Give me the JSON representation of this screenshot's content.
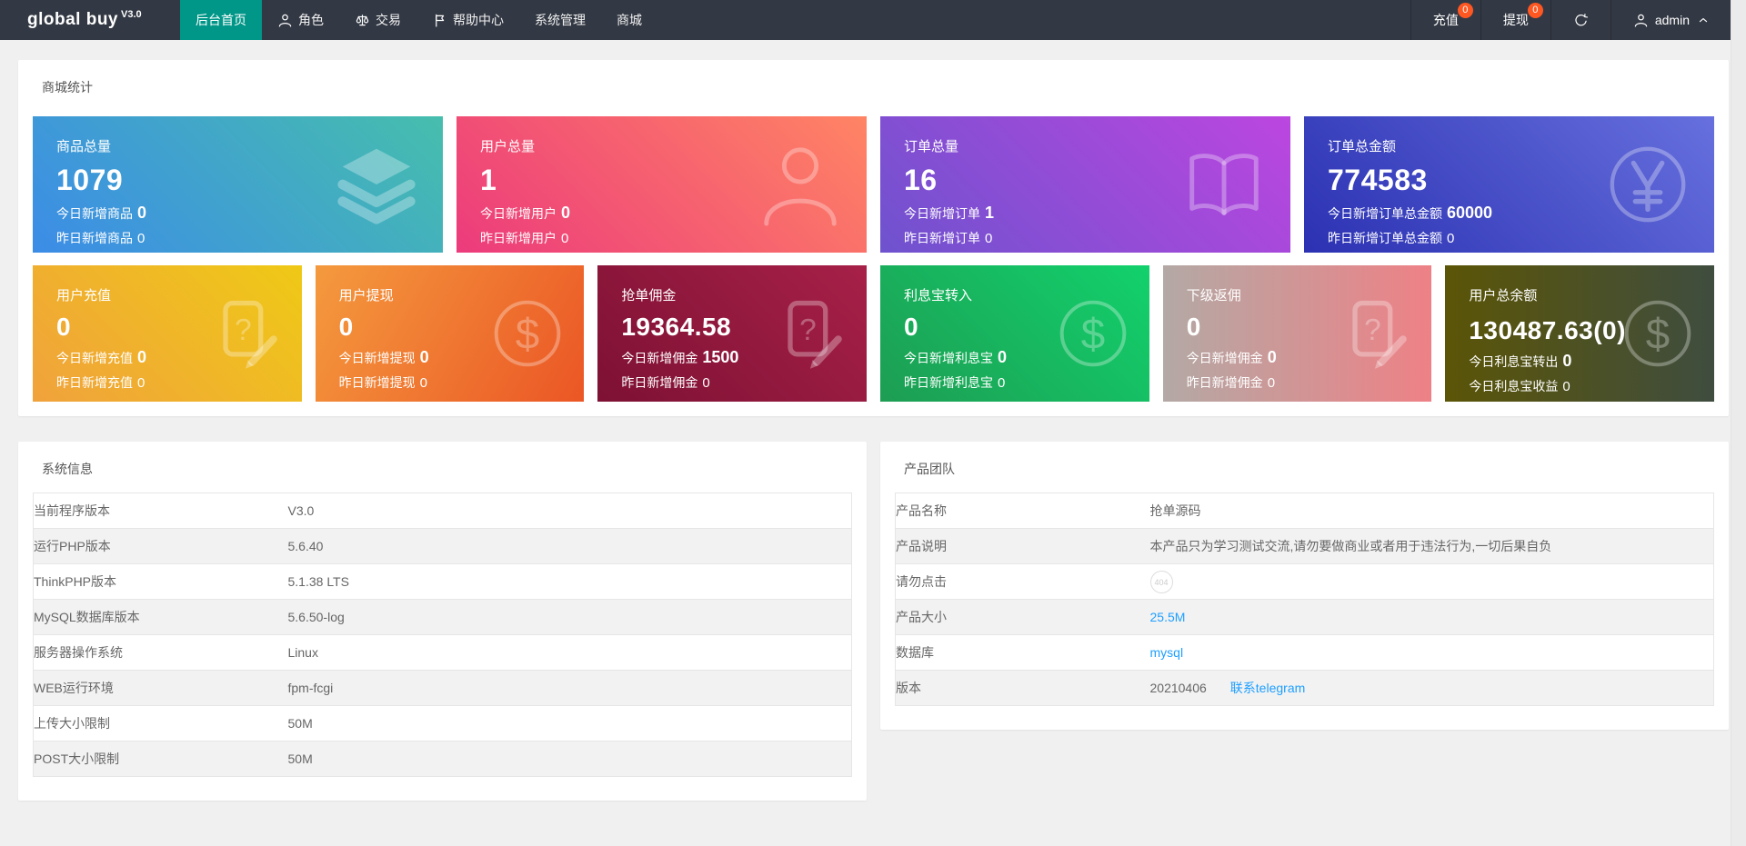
{
  "navbar": {
    "logo_text": "global buy",
    "logo_version": "V3.0",
    "menu": [
      {
        "name": "home",
        "label": "后台首页",
        "active": true
      },
      {
        "name": "roles",
        "label": "角色",
        "icon": "user-icon"
      },
      {
        "name": "trade",
        "label": "交易",
        "icon": "scales-icon"
      },
      {
        "name": "help",
        "label": "帮助中心",
        "icon": "flag-icon"
      },
      {
        "name": "system",
        "label": "系统管理"
      },
      {
        "name": "mall",
        "label": "商城"
      }
    ],
    "actions": [
      {
        "name": "recharge",
        "label": "充值",
        "badge": "0"
      },
      {
        "name": "withdraw",
        "label": "提现",
        "badge": "0"
      },
      {
        "name": "refresh",
        "icon": "refresh-icon"
      },
      {
        "name": "user-menu",
        "label": "admin",
        "icon": "user-icon",
        "caret": true
      }
    ]
  },
  "stats": {
    "title": "商城统计",
    "row1": [
      {
        "name": "goods-total",
        "title": "商品总量",
        "value": "1079",
        "today_label": "今日新增商品",
        "today_value": "0",
        "yesterday_label": "昨日新增商品",
        "yesterday_value": "0",
        "icon": "layers-icon",
        "gradient": [
          "#3C8CE7",
          "#46BEAD"
        ],
        "angle": "45deg"
      },
      {
        "name": "user-total",
        "title": "用户总量",
        "value": "1",
        "today_label": "今日新增用户",
        "today_value": "0",
        "yesterday_label": "昨日新增用户",
        "yesterday_value": "0",
        "icon": "person-icon",
        "gradient": [
          "#EC3B7C",
          "#FF8464"
        ],
        "angle": "45deg"
      },
      {
        "name": "order-total",
        "title": "订单总量",
        "value": "16",
        "today_label": "今日新增订单",
        "today_value": "1",
        "yesterday_label": "昨日新增订单",
        "yesterday_value": "0",
        "icon": "book-icon",
        "gradient": [
          "#6E52CE",
          "#BC46E0"
        ],
        "angle": "45deg"
      },
      {
        "name": "order-amount",
        "title": "订单总金额",
        "value": "774583",
        "today_label": "今日新增订单总金额",
        "today_value": "60000",
        "yesterday_label": "昨日新增订单总金额",
        "yesterday_value": "0",
        "icon": "yen-icon",
        "gradient": [
          "#2B31B2",
          "#6770DE"
        ],
        "angle": "45deg"
      }
    ],
    "row2": [
      {
        "name": "user-recharge",
        "title": "用户充值",
        "value": "0",
        "today_label": "今日新增充值",
        "today_value": "0",
        "yesterday_label": "昨日新增充值",
        "yesterday_value": "0",
        "icon": "doc-question-icon",
        "gradient": [
          "#F0A23C",
          "#EFC916"
        ],
        "angle": "45deg"
      },
      {
        "name": "user-withdraw",
        "title": "用户提现",
        "value": "0",
        "today_label": "今日新增提现",
        "today_value": "0",
        "yesterday_label": "昨日新增提现",
        "yesterday_value": "0",
        "icon": "dollar-icon",
        "gradient": [
          "#F49A3E",
          "#EB5625"
        ],
        "angle": "120deg"
      },
      {
        "name": "order-commission",
        "title": "抢单佣金",
        "value": "19364.58",
        "today_label": "今日新增佣金",
        "today_value": "1500",
        "yesterday_label": "昨日新增佣金",
        "yesterday_value": "0",
        "icon": "doc-question-icon",
        "gradient": [
          "#7D1134",
          "#A72048"
        ],
        "angle": "45deg"
      },
      {
        "name": "interest-in",
        "title": "利息宝转入",
        "value": "0",
        "today_label": "今日新增利息宝",
        "today_value": "0",
        "yesterday_label": "昨日新增利息宝",
        "yesterday_value": "0",
        "icon": "dollar-icon",
        "gradient": [
          "#1D9D53",
          "#12D16C"
        ],
        "angle": "45deg"
      },
      {
        "name": "sub-commission",
        "title": "下级返佣",
        "value": "0",
        "today_label": "今日新增佣金",
        "today_value": "0",
        "yesterday_label": "昨日新增佣金",
        "yesterday_value": "0",
        "icon": "doc-question-icon",
        "gradient": [
          "#B3A9A5",
          "#EE8186"
        ],
        "angle": "90deg"
      },
      {
        "name": "user-balance",
        "title": "用户总余额",
        "value": "130487.63(0)",
        "value_small": true,
        "today_label": "今日利息宝转出",
        "today_value": "0",
        "yesterday_label": "今日利息宝收益",
        "yesterday_value": "0",
        "icon": "dollar-icon",
        "gradient": [
          "#5B5507",
          "#3F4D3F"
        ],
        "angle": "90deg"
      }
    ]
  },
  "system_info": {
    "title": "系统信息",
    "rows": [
      {
        "label": "当前程序版本",
        "value": "V3.0"
      },
      {
        "label": "运行PHP版本",
        "value": "5.6.40"
      },
      {
        "label": "ThinkPHP版本",
        "value": "5.1.38 LTS"
      },
      {
        "label": "MySQL数据库版本",
        "value": "5.6.50-log"
      },
      {
        "label": "服务器操作系统",
        "value": "Linux"
      },
      {
        "label": "WEB运行环境",
        "value": "fpm-fcgi"
      },
      {
        "label": "上传大小限制",
        "value": "50M"
      },
      {
        "label": "POST大小限制",
        "value": "50M"
      }
    ]
  },
  "product_team": {
    "title": "产品团队",
    "rows": [
      {
        "label": "产品名称",
        "value": "抢单源码"
      },
      {
        "label": "产品说明",
        "value": "本产品只为学习测试交流,请勿要做商业或者用于违法行为,一切后果自负"
      },
      {
        "label": "请勿点击",
        "badge404": "404"
      },
      {
        "label": "产品大小",
        "link": "25.5M"
      },
      {
        "label": "数据库",
        "link": "mysql"
      },
      {
        "label": "版本",
        "value": "20210406",
        "link": "联系telegram"
      }
    ]
  },
  "colors": {
    "nav_bg": "#333944",
    "accent": "#009688",
    "badge": "#FF5722",
    "link": "#1E9FFF",
    "page_bg": "#F0F0F0"
  }
}
